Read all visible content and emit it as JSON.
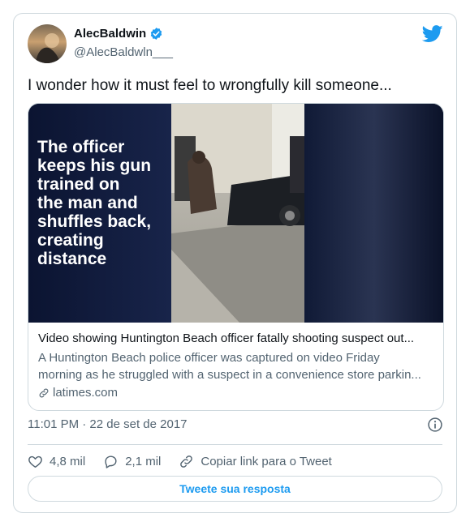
{
  "author": {
    "name": "AlecBaldwin",
    "handle": "@AlecBaldwln___",
    "verified": true
  },
  "tweet": {
    "text": "I wonder how it must feel to wrongfully kill someone..."
  },
  "link_card": {
    "overlay_text": [
      "The officer",
      "keeps his gun",
      "trained on",
      "the man and",
      "shuffles back,",
      "creating",
      "distance"
    ],
    "title": "Video showing Huntington Beach officer fatally shooting suspect out...",
    "description_line1": "A Huntington Beach police officer was captured on video Friday",
    "description_line2": "morning as he struggled with a suspect in a convenience store parkin...",
    "domain": "latimes.com"
  },
  "timestamp": "11:01 PM · 22 de set de 2017",
  "actions": {
    "likes": "4,8 mil",
    "replies": "2,1 mil",
    "copy_link": "Copiar link para o Tweet"
  },
  "reply_button": "Tweete sua resposta",
  "colors": {
    "brand_blue": "#1d9bf0",
    "muted_text": "#536471",
    "border": "#cfd9de",
    "text": "#0f1419"
  },
  "icons": [
    "twitter-bird-icon",
    "verified-badge-icon",
    "link-icon",
    "info-icon",
    "heart-icon",
    "reply-bubble-icon",
    "chain-link-icon"
  ]
}
